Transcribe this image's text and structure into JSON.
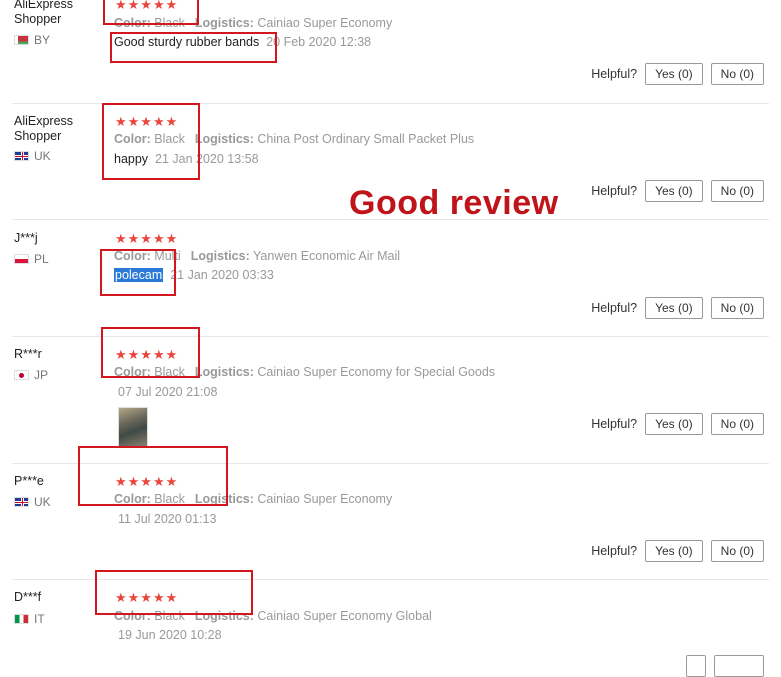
{
  "overlay_title": "Good review",
  "helpful_label": "Helpful?",
  "yes_label": "Yes (0)",
  "no_label": "No (0)",
  "stars": "★★★★★",
  "color_label": "Color:",
  "logistics_label": "Logistics:",
  "reviews": [
    {
      "name": "AliExpress Shopper",
      "country": "BY",
      "color": "Black",
      "logistics": "Cainiao Super Economy",
      "feedback": "Good sturdy rubber bands",
      "date": "20 Feb 2020 12:38"
    },
    {
      "name": "AliExpress Shopper",
      "country": "UK",
      "color": "Black",
      "logistics": "China Post Ordinary Small Packet Plus",
      "feedback": "happy",
      "date": "21 Jan 2020 13:58"
    },
    {
      "name": "J***j",
      "country": "PL",
      "color": "Multi",
      "logistics": "Yanwen Economic Air Mail",
      "feedback": "polecam",
      "date": "21 Jan 2020 03:33"
    },
    {
      "name": "R***r",
      "country": "JP",
      "color": "Black",
      "logistics": "Cainiao Super Economy for Special Goods",
      "feedback": "",
      "date": "07 Jul 2020 21:08"
    },
    {
      "name": "P***e",
      "country": "UK",
      "color": "Black",
      "logistics": "Cainiao Super Economy",
      "feedback": "",
      "date": "11 Jul 2020 01:13"
    },
    {
      "name": "D***f",
      "country": "IT",
      "color": "Black",
      "logistics": "Cainiao Super Economy Global",
      "feedback": "",
      "date": "19 Jun 2020 10:28"
    }
  ],
  "colors": {
    "accent_red": "#d2171f",
    "star_red": "#e8453c",
    "highlight_blue": "#2a79d8"
  }
}
